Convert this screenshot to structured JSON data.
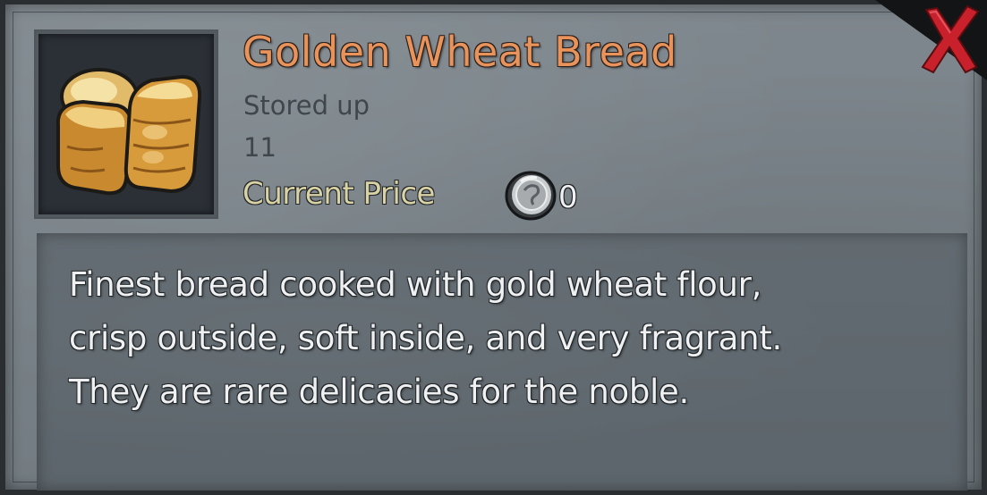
{
  "item": {
    "name": "Golden Wheat Bread",
    "stored_label": "Stored up",
    "stored_value": "11",
    "price_label": "Current Price",
    "price_value": "0",
    "icon": "bread-loaves-icon",
    "currency_icon": "silver-coin-icon"
  },
  "description": {
    "lines": [
      "Finest bread cooked with gold wheat flour,",
      "crisp outside, soft inside, and very fragrant.",
      "They are rare delicacies for the noble."
    ]
  },
  "controls": {
    "close_icon": "close-icon"
  },
  "colors": {
    "title": "#e8935c",
    "price_label": "#d9d2a4",
    "close": "#c8212b",
    "panel": "#7a8389"
  }
}
